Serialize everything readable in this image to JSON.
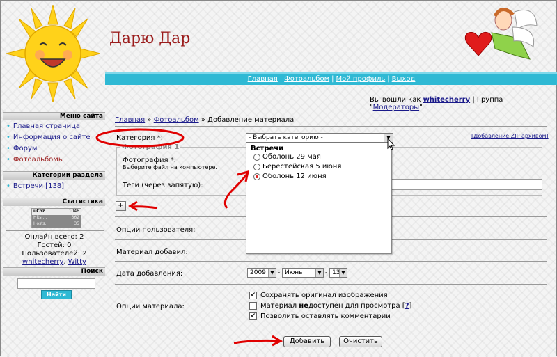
{
  "site": {
    "title": "Дарю Дар"
  },
  "topnav": {
    "items": [
      "Главная",
      "Фотоальбом",
      "Мой профиль",
      "Выход"
    ]
  },
  "login": {
    "prefix": "Вы вошли как",
    "user": "whitecherry",
    "group_prefix": "| Группа \"",
    "group": "Модераторы",
    "group_suffix": "\""
  },
  "sidebar": {
    "menu_title": "Меню сайта",
    "menu_items": [
      "Главная страница",
      "Информация о сайте",
      "Форум",
      "Фотоальбомы"
    ],
    "categories_title": "Категории раздела",
    "categories": [
      "Встречи [138]"
    ],
    "stats_title": "Статистика",
    "counter": {
      "row1_label": "uCoz",
      "row1_value": "1046",
      "row2_label": "Hits....",
      "row2_value": "362",
      "row3_label": "Hosts..",
      "row3_value": "35"
    },
    "online_total": "Онлайн всего: 2",
    "guests": "Гостей: 0",
    "users": "Пользователей: 2",
    "online_user1": "whitecherry",
    "online_user2": "Witty",
    "search_title": "Поиск",
    "search_button": "Найти"
  },
  "breadcrumb": {
    "home": "Главная",
    "album": "Фотоальбом",
    "current": "Добавление материала",
    "sep": "»"
  },
  "form": {
    "category_label": "Категория *:",
    "category_value": "- Выбрать категорию -",
    "zip_link": "[Добавление ZIP архивом]",
    "fieldset_legend": "Фотография 1",
    "photo_label": "Фотография *:",
    "photo_hint": "Выберите файл на компьютере.",
    "tags_label": "Теги (через запятую):",
    "plus": "+",
    "user_options_label": "Опции пользователя:",
    "added_by_label": "Материал добавил:",
    "date_label": "Дата добавления:",
    "date_year": "2009",
    "date_month": "Июнь",
    "date_day": "13",
    "date_sep": "-",
    "material_options_label": "Опции материала:",
    "opt1": "Сохранять оригинал изображения",
    "opt2_a": "Материал ",
    "opt2_b": "не",
    "opt2_c": "доступен для просмотра [",
    "opt2_q": "?",
    "opt2_d": "]",
    "opt3": "Позволить оставлять комментарии",
    "opt1_checked": true,
    "opt2_checked": false,
    "opt3_checked": true,
    "submit": "Добавить",
    "reset": "Очистить"
  },
  "dropdown": {
    "group": "Встречи",
    "options": [
      "Оболонь 29 мая",
      "Берестейская 5 июня",
      "Оболонь 12 июня"
    ],
    "selected_index": 2
  },
  "colors": {
    "accent": "#2fb9d4",
    "title": "#9b1c1c",
    "annotation": "#e00000",
    "link": "#1a1a8a"
  }
}
